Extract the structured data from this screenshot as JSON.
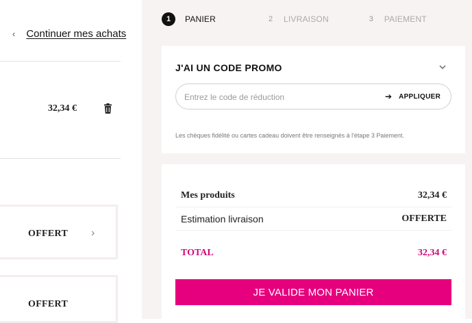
{
  "nav": {
    "continue_label": "Continuer mes achats"
  },
  "cart_item": {
    "price": "32,34 €"
  },
  "offers": [
    {
      "label": "OFFERT"
    },
    {
      "label": "OFFERT"
    }
  ],
  "steps": [
    {
      "number": "1",
      "label": "PANIER",
      "active": true
    },
    {
      "number": "2",
      "label": "LIVRAISON",
      "active": false
    },
    {
      "number": "3",
      "label": "PAIEMENT",
      "active": false
    }
  ],
  "promo": {
    "title": "J'AI UN CODE PROMO",
    "placeholder": "Entrez le code de réduction",
    "apply_label": "APPLIQUER",
    "note": "Les chèques fidélité ou cartes cadeau doivent être renseignés à l'étape 3 Paiement."
  },
  "summary": {
    "products_label": "Mes produits",
    "products_value": "32,34 €",
    "shipping_label": "Estimation livraison",
    "shipping_value": "OFFERTE",
    "total_label": "TOTAL",
    "total_value": "32,34 €",
    "validate_label": "JE VALIDE MON PANIER"
  },
  "colors": {
    "accent": "#e6007e",
    "total": "#cc0a7a",
    "panel_bg": "#f7f3f2"
  },
  "icons": [
    "chevron-left-icon",
    "trash-icon",
    "chevron-right-icon",
    "chevron-down-icon",
    "arrow-right-icon"
  ]
}
